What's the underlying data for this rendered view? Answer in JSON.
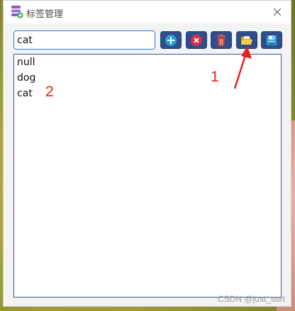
{
  "window": {
    "title": "标签管理"
  },
  "toolbar": {
    "input_value": "cat",
    "buttons": [
      {
        "name": "add",
        "icon": "plus-circle-icon",
        "color": "#26a0d8"
      },
      {
        "name": "delete",
        "icon": "x-circle-icon",
        "color": "#d1324a"
      },
      {
        "name": "trash",
        "icon": "trash-icon",
        "color": "#d04a3a"
      },
      {
        "name": "open",
        "icon": "folder-open-icon",
        "color": "#f2c230"
      },
      {
        "name": "save",
        "icon": "floppy-disk-icon",
        "color": "#2aa4dd"
      }
    ]
  },
  "list": {
    "items": [
      "null",
      "dog",
      "cat"
    ]
  },
  "annotations": {
    "label_1": "1",
    "label_2": "2"
  },
  "watermark": "CSDN @just_sort"
}
